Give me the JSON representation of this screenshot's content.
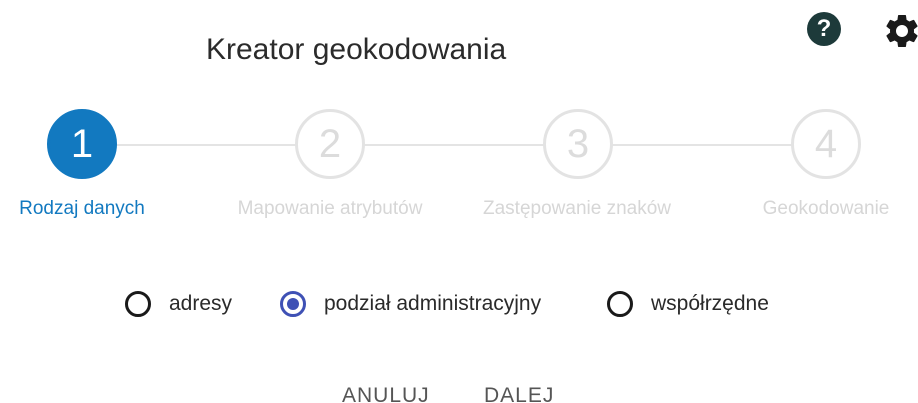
{
  "header": {
    "title": "Kreator geokodowania",
    "help_icon_glyph": "?",
    "icons": [
      "help-icon",
      "gear-icon"
    ]
  },
  "stepper": {
    "active_step": 1,
    "steps": [
      {
        "number": "1",
        "label": "Rodzaj danych"
      },
      {
        "number": "2",
        "label": "Mapowanie atrybutów"
      },
      {
        "number": "3",
        "label": "Zastępowanie znaków"
      },
      {
        "number": "4",
        "label": "Geokodowanie"
      }
    ]
  },
  "data_type": {
    "options": [
      {
        "label": "adresy",
        "selected": false
      },
      {
        "label": "podział administracyjny",
        "selected": true
      },
      {
        "label": "współrzędne",
        "selected": false
      }
    ]
  },
  "actions": {
    "cancel_label": "ANULUJ",
    "next_label": "DALEJ"
  },
  "colors": {
    "accent": "#1279c0",
    "radio_selected": "#3f51b5",
    "inactive_step": "#e3e3e3",
    "help_icon_bg": "#1d3a3a"
  }
}
